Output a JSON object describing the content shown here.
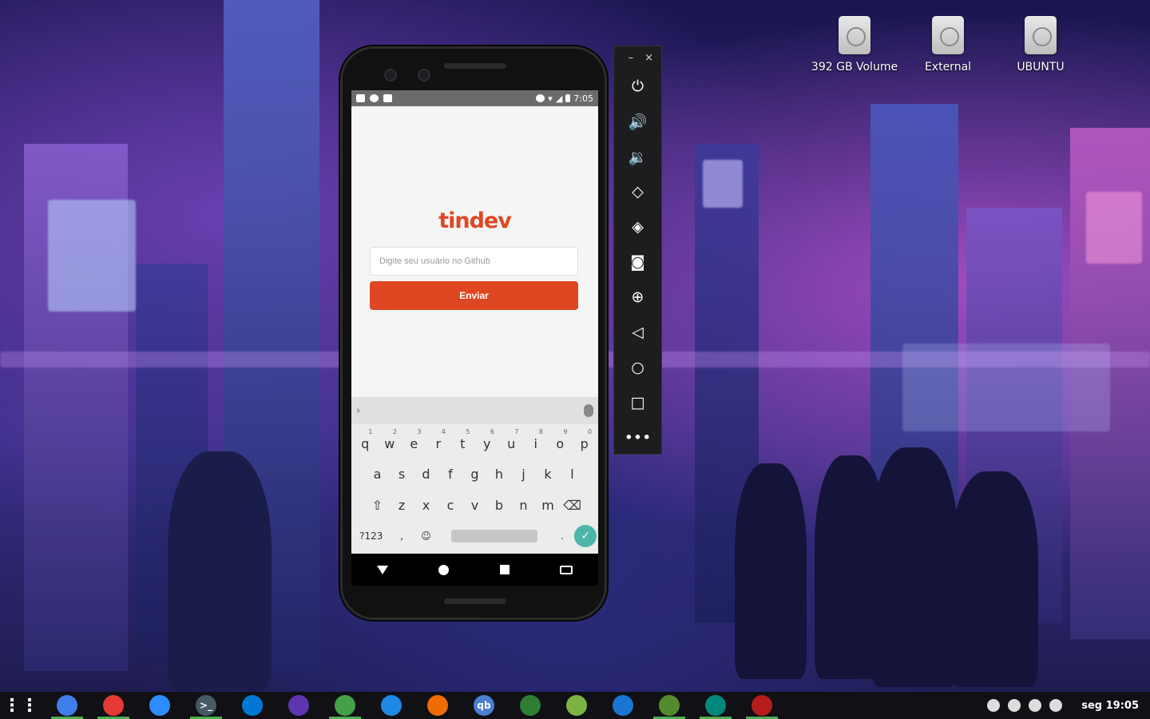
{
  "desktop": {
    "icons": [
      {
        "label": "392 GB Volume",
        "icon": "drive-icon"
      },
      {
        "label": "External",
        "icon": "drive-icon"
      },
      {
        "label": "UBUNTU",
        "icon": "drive-icon"
      }
    ]
  },
  "phone": {
    "status": {
      "time": "7:05"
    },
    "app": {
      "logo": "tindev",
      "input_placeholder": "Digite seu usuário no Github",
      "button_label": "Enviar"
    },
    "keyboard": {
      "row1": [
        {
          "k": "q",
          "n": "1"
        },
        {
          "k": "w",
          "n": "2"
        },
        {
          "k": "e",
          "n": "3"
        },
        {
          "k": "r",
          "n": "4"
        },
        {
          "k": "t",
          "n": "5"
        },
        {
          "k": "y",
          "n": "6"
        },
        {
          "k": "u",
          "n": "7"
        },
        {
          "k": "i",
          "n": "8"
        },
        {
          "k": "o",
          "n": "9"
        },
        {
          "k": "p",
          "n": "0"
        }
      ],
      "row2": [
        "a",
        "s",
        "d",
        "f",
        "g",
        "h",
        "j",
        "k",
        "l"
      ],
      "row3": [
        "z",
        "x",
        "c",
        "v",
        "b",
        "n",
        "m"
      ],
      "symbols_key": "?123",
      "comma_key": ",",
      "period_key": "."
    }
  },
  "emulator_toolbar": {
    "minimize": "–",
    "close": "×",
    "buttons": [
      "power-icon",
      "volume-up-icon",
      "volume-down-icon",
      "rotate-left-icon",
      "rotate-right-icon",
      "camera-icon",
      "zoom-icon",
      "back-icon",
      "home-icon",
      "overview-icon",
      "more-icon"
    ]
  },
  "taskbar": {
    "apps": [
      {
        "name": "app-grid-icon",
        "color": "#ffffff",
        "glyph": "",
        "active": false
      },
      {
        "name": "files-icon",
        "color": "#3f7de8",
        "glyph": "",
        "active": true
      },
      {
        "name": "chrome-icon",
        "color": "#e53935",
        "glyph": "",
        "active": true
      },
      {
        "name": "zoom-icon",
        "color": "#2d8cff",
        "glyph": "",
        "active": false
      },
      {
        "name": "terminal-icon",
        "color": "#455a64",
        "glyph": ">_",
        "active": true
      },
      {
        "name": "vscode-icon",
        "color": "#0078d4",
        "glyph": "",
        "active": false
      },
      {
        "name": "circle-app-icon",
        "color": "#5e35b1",
        "glyph": "",
        "active": false
      },
      {
        "name": "mongodb-icon",
        "color": "#43a047",
        "glyph": "",
        "active": true
      },
      {
        "name": "box-app-icon",
        "color": "#1e88e5",
        "glyph": "",
        "active": false
      },
      {
        "name": "vlc-icon",
        "color": "#ef6c00",
        "glyph": "",
        "active": false
      },
      {
        "name": "qbittorrent-icon",
        "color": "#4a7fd1",
        "glyph": "qb",
        "active": false
      },
      {
        "name": "settings-app-icon",
        "color": "#2e7d32",
        "glyph": "",
        "active": false
      },
      {
        "name": "android-app-icon",
        "color": "#7cb342",
        "glyph": "",
        "active": false
      },
      {
        "name": "grid-app-icon",
        "color": "#1976d2",
        "glyph": "",
        "active": false
      },
      {
        "name": "android-studio-icon",
        "color": "#558b2f",
        "glyph": "",
        "active": true
      },
      {
        "name": "emulator-icon",
        "color": "#00897b",
        "glyph": "",
        "active": true
      },
      {
        "name": "red-app-icon",
        "color": "#b71c1c",
        "glyph": "",
        "active": true
      }
    ],
    "clock": "seg 19:05"
  }
}
